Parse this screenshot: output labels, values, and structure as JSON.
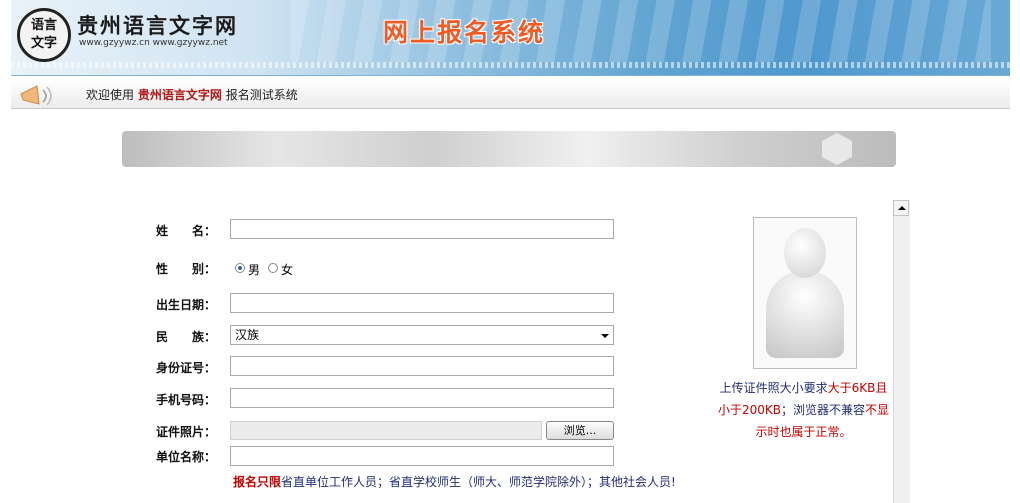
{
  "header": {
    "logo_mark_line1": "语言",
    "logo_mark_line2": "文字",
    "logo_title": "贵州语言文字网",
    "logo_urls": "www.gzyywz.cn  www.gzyywz.net",
    "system_title": "网上报名系统"
  },
  "welcome": {
    "prefix": "欢迎使用",
    "site_name": "贵州语言文字网",
    "suffix": "报名测试系统"
  },
  "form": {
    "name_label": "姓　　名：",
    "gender_label": "性　　别：",
    "gender_male": "男",
    "gender_female": "女",
    "gender_selected": "男",
    "birth_label": "出生日期：",
    "ethnicity_label": "民　　族：",
    "ethnicity_value": "汉族",
    "id_label": "身份证号：",
    "phone_label": "手机号码：",
    "photo_label": "证件照片：",
    "browse_label": "浏览...",
    "org_label": "单位名称：",
    "note_highlight": "报名只限",
    "note_text": "省直单位工作人员；省直学校师生（师大、师范学院除外）；其他社会人员!"
  },
  "photo_hint": {
    "part1": "上传证件照大小要求",
    "part2": "大于",
    "part3": "6KB且小于200KB",
    "part4": "；浏览器不兼容",
    "part5": "不显示时也属于正常。"
  },
  "icons": {
    "logo": "logo-seal-icon",
    "horn": "megaphone-icon",
    "avatar": "person-silhouette-icon"
  },
  "colors": {
    "system_title": "#f15a24",
    "site_name": "#b01818",
    "note_highlight": "#c40000",
    "note_text": "#1f2d7a"
  }
}
